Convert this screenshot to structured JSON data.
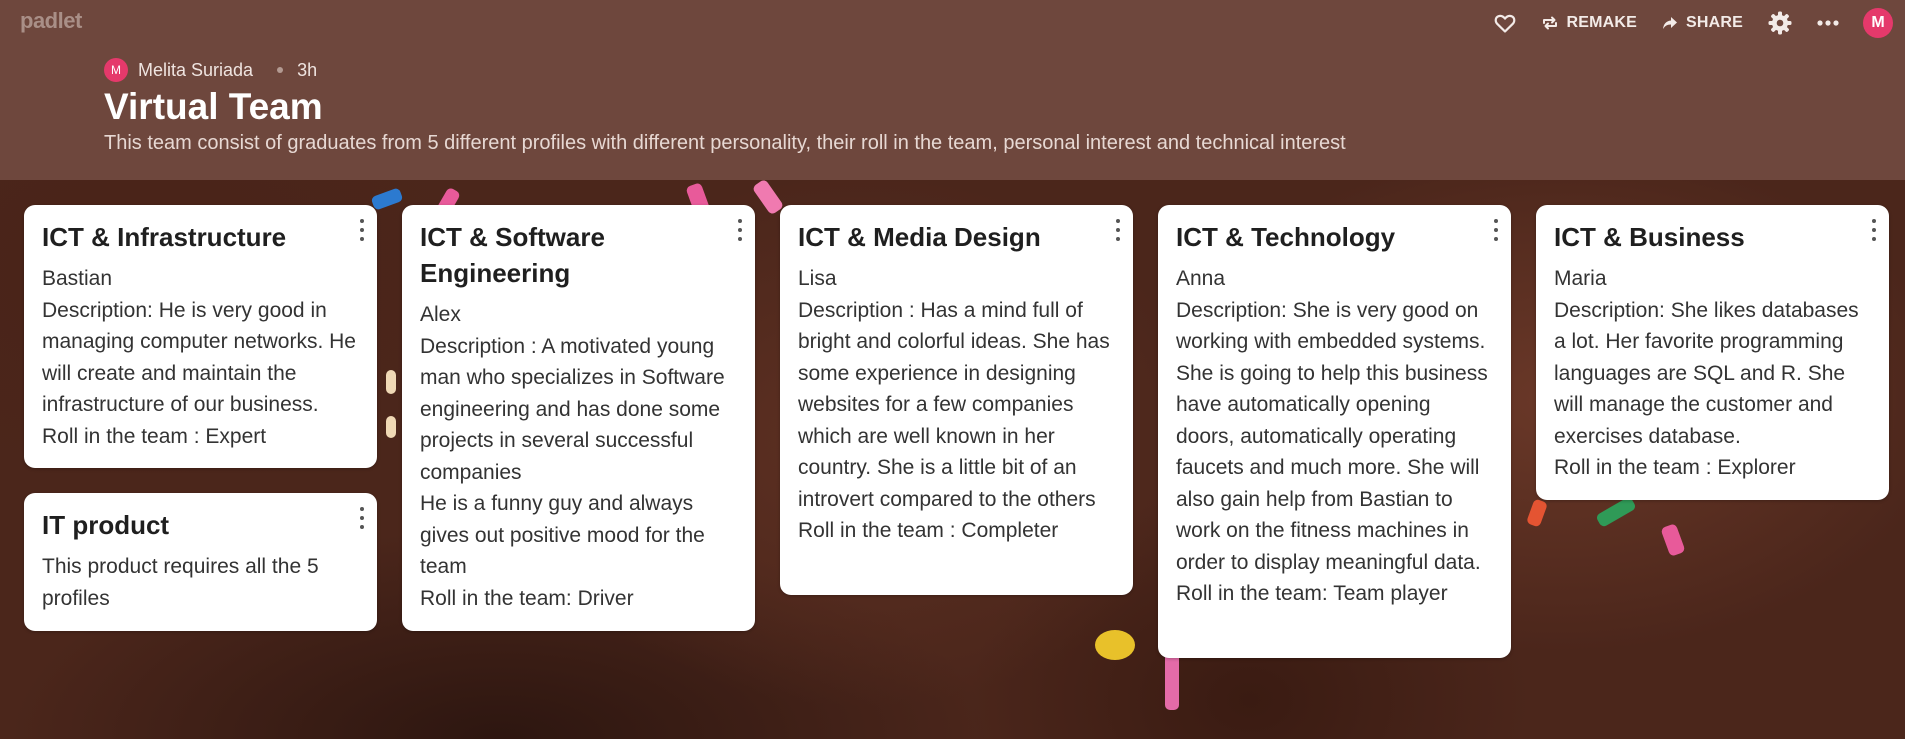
{
  "app": {
    "logo": "padlet"
  },
  "topbar": {
    "remake_label": "REMAKE",
    "share_label": "SHARE",
    "user_initial": "M"
  },
  "header": {
    "author_initial": "M",
    "author": "Melita Suriada",
    "time": "3h",
    "title": "Virtual Team",
    "description": "This team consist of graduates from 5 different profiles with different personality, their roll in the team, personal interest and technical interest"
  },
  "posts": [
    {
      "title": "ICT & Infrastructure",
      "body": "Bastian\nDescription: He is very good in managing computer networks. He will create and maintain the infrastructure of our business.\nRoll in the team : Expert"
    },
    {
      "title": "IT product",
      "body": "This product requires all the 5 profiles"
    },
    {
      "title": "ICT & Software Engineering",
      "body": "Alex\nDescription : A motivated young man who specializes in Software engineering and has done some projects in several successful companies\nHe is a funny guy and always gives out positive mood for the team\nRoll in the team: Driver"
    },
    {
      "title": "ICT & Media Design",
      "body": "Lisa\nDescription : Has a mind full of bright and colorful ideas. She has some experience in designing websites for a few companies which are well known in her country. She is a little bit of an introvert compared to the others\nRoll in the team : Completer"
    },
    {
      "title": "ICT & Technology",
      "body": "Anna\nDescription: She is very good on working with embedded systems. She is going to help this business have automatically opening doors, automatically operating faucets and much more. She will also gain help from Bastian to work on the fitness machines in order to display meaningful data.\nRoll in the team: Team player"
    },
    {
      "title": "ICT & Business",
      "body": "Maria\nDescription: She likes databases a lot. Her favorite programming languages are SQL and R. She will manage the customer and exercises database.\nRoll in the team : Explorer"
    }
  ],
  "colors": {
    "header": "#6e473d",
    "avatar": "#e5396b"
  }
}
